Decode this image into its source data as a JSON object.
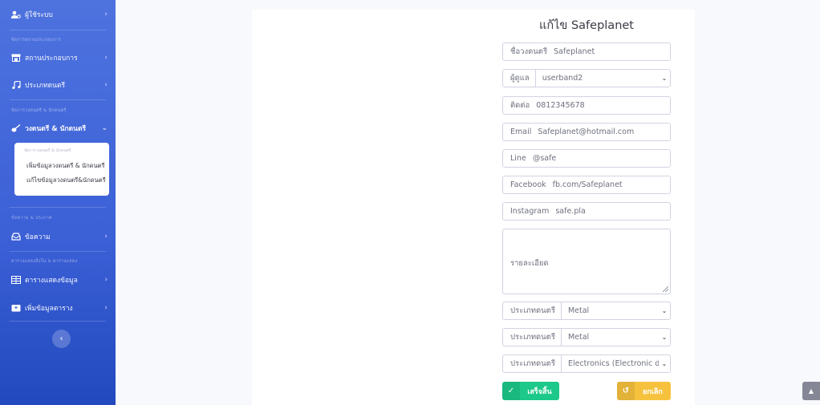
{
  "sidebar": {
    "items": [
      {
        "label": "ผู้ใช้ระบบ",
        "icon": "users-cog-icon"
      },
      {
        "label": "สถานประกอบการ",
        "icon": "store-icon"
      },
      {
        "label": "ประเภทดนตรี",
        "icon": "music-icon"
      },
      {
        "label": "วงดนตรี & นักดนตรี",
        "icon": "guitar-icon"
      },
      {
        "label": "ข้อความ",
        "icon": "inbox-icon"
      },
      {
        "label": "ตารางแสดงข้อมูล",
        "icon": "table-icon"
      },
      {
        "label": "เพิ่มข้อมูลตาราง",
        "icon": "calendar-plus-icon"
      }
    ],
    "headings": [
      "จัดการสถานประกอบการ",
      "จัดการวงดนตรี & นักดนตรี",
      "ข้อความ & ประกาศ",
      "ตารางแสดงสิ่งใน & ตารางแสดง"
    ],
    "submenu": {
      "heading": "จัดการวงดนตรี & นักดนตรี",
      "items": [
        "เพิ่มข้อมูลวงดนตรี & นักดนตรี",
        "แก้ไขข้อมูลวงดนตรี&นักดนตรี"
      ]
    },
    "toggle_glyph": "‹"
  },
  "form": {
    "title": "แก้ไข Safeplanet",
    "band_name": {
      "label": "ชื่อวงดนตรี",
      "value": "Safeplanet"
    },
    "manager": {
      "label": "ผู้ดูแล",
      "value": "userband2"
    },
    "contact": {
      "label": "ติดต่อ",
      "value": "0812345678"
    },
    "email": {
      "label": "Email",
      "value": "Safeplanet@hotmail.com"
    },
    "line": {
      "label": "Line",
      "value": "@safe"
    },
    "facebook": {
      "label": "Facebook",
      "value": "fb.com/Safeplanet"
    },
    "instagram": {
      "label": "Instagram",
      "value": "safe.pla"
    },
    "details": {
      "label": "รายละเอียด"
    },
    "genre1": {
      "label": "ประเภทดนตรี",
      "value": "Metal"
    },
    "genre2": {
      "label": "ประเภทดนตรี",
      "value": "Metal"
    },
    "genre3": {
      "label": "ประเภทดนตรี",
      "value": "Electronics (Electronic dai"
    },
    "save_label": "เสร็จสิ้น",
    "cancel_label": "ยกเลิก"
  },
  "colors": {
    "sidebar": "#4e73df",
    "success": "#1cc88a",
    "warning": "#f6c23e"
  }
}
